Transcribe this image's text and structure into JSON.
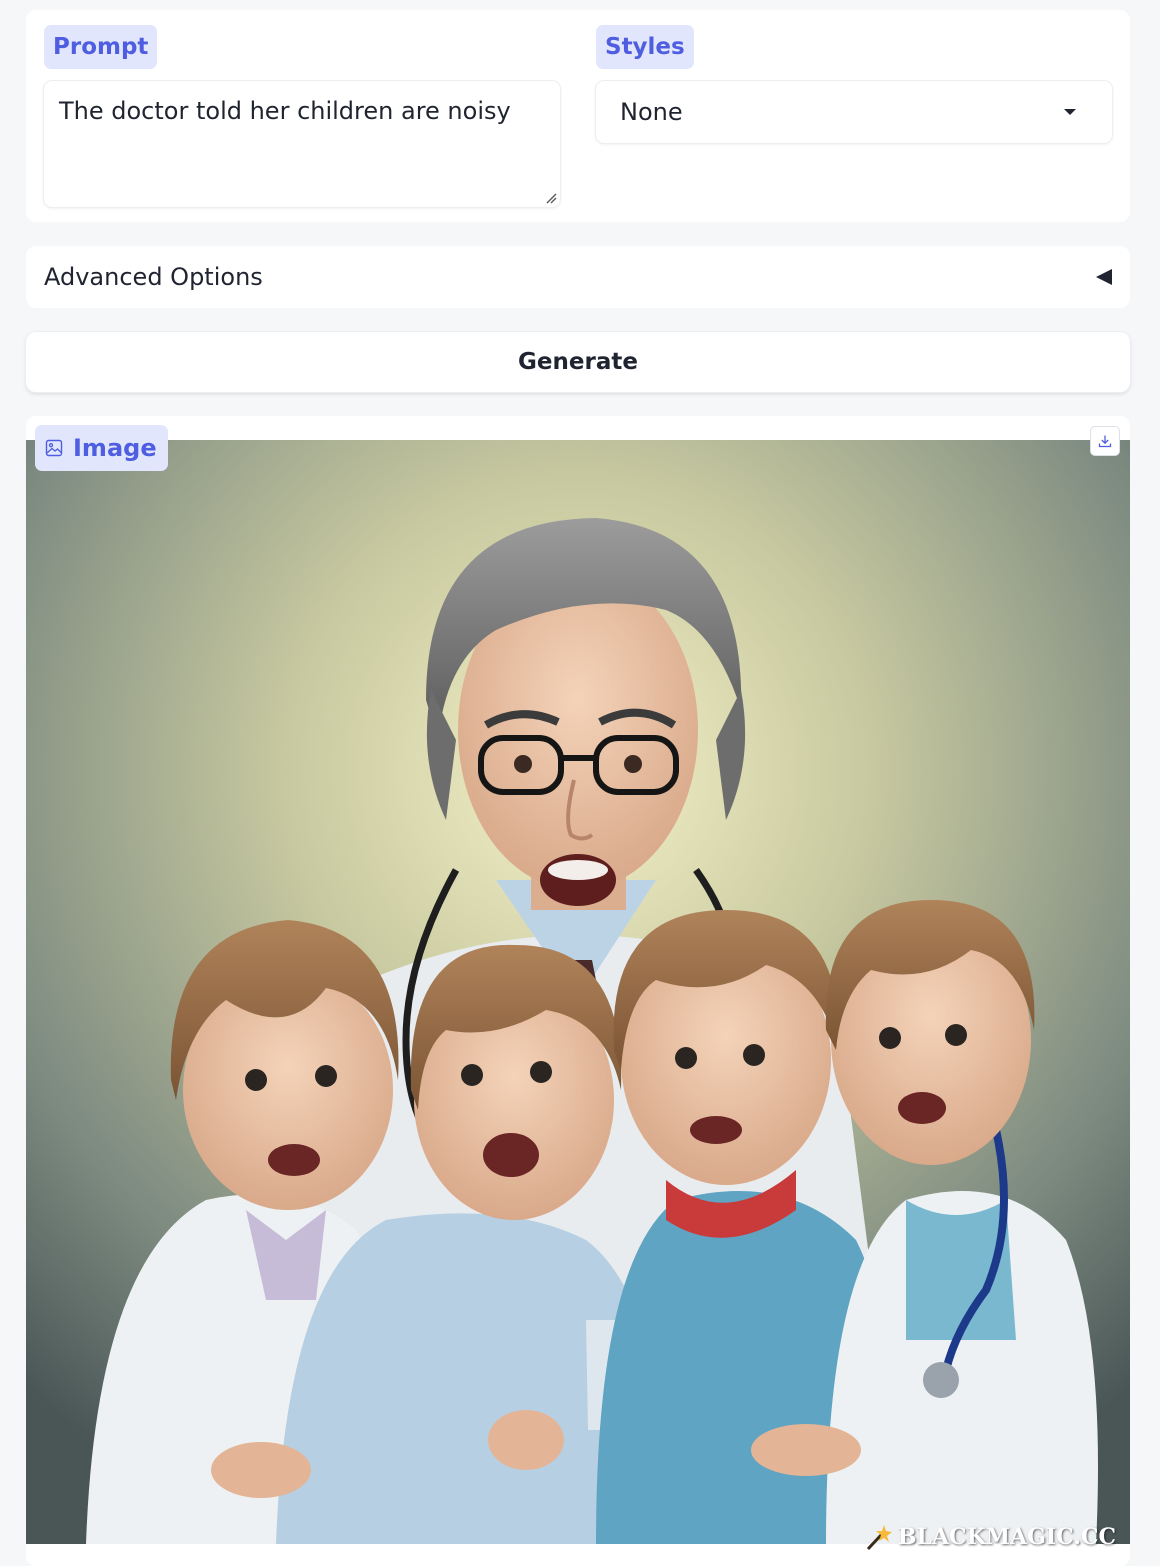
{
  "prompt": {
    "label": "Prompt",
    "value": "The doctor told her children are noisy"
  },
  "styles": {
    "label": "Styles",
    "selected": "None"
  },
  "advanced": {
    "label": "Advanced Options"
  },
  "generate": {
    "label": "Generate"
  },
  "output": {
    "label": "Image",
    "watermark": "BLACKMAGIC.CC"
  },
  "colors": {
    "accent": "#4f5ee0",
    "chip_bg": "#e2e6fd",
    "page_bg": "#f6f7f9"
  }
}
